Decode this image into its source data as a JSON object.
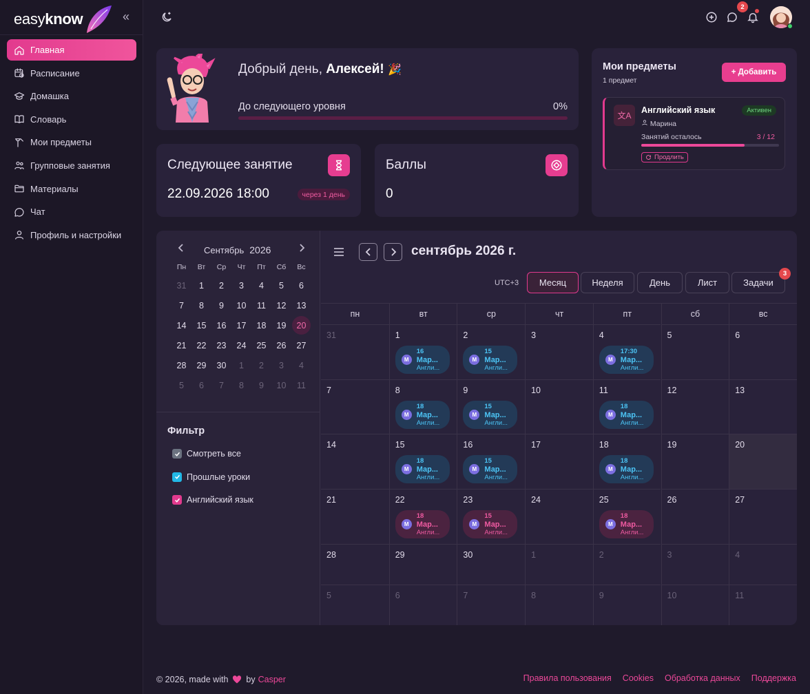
{
  "brand": {
    "logo_light": "easy",
    "logo_bold": "know",
    "accent": "#ec4899"
  },
  "sidebar": {
    "items": [
      {
        "label": "Главная",
        "icon": "home-icon",
        "active": true
      },
      {
        "label": "Расписание",
        "icon": "calendar-clock-icon"
      },
      {
        "label": "Домашка",
        "icon": "graduation-cap-icon"
      },
      {
        "label": "Словарь",
        "icon": "book-icon"
      },
      {
        "label": "Мои предметы",
        "icon": "tools-icon"
      },
      {
        "label": "Групповые занятия",
        "icon": "users-icon"
      },
      {
        "label": "Материалы",
        "icon": "folder-icon"
      },
      {
        "label": "Чат",
        "icon": "chat-icon"
      },
      {
        "label": "Профиль и настройки",
        "icon": "user-icon"
      }
    ]
  },
  "topbar": {
    "chat_badge": "2"
  },
  "greeting": {
    "prefix": "Добрый день, ",
    "name": "Алексей!",
    "emoji": "🎉",
    "level_label": "До следующего уровня",
    "level_value": "0%",
    "level_progress": 0
  },
  "next_lesson": {
    "title": "Следующее занятие",
    "datetime": "22.09.2026 18:00",
    "in": "через 1 день"
  },
  "score": {
    "title": "Баллы",
    "value": "0"
  },
  "subjects": {
    "title": "Мои предметы",
    "count": "1 предмет",
    "add_label": "+ Добавить",
    "card": {
      "icon_text": "文A",
      "name": "Английский язык",
      "status": "Активен",
      "teacher": "Марина",
      "left_label": "Занятий осталось",
      "left_value": "3 / 12",
      "progress": 0.75,
      "renew_label": "Продлить"
    }
  },
  "mini_calendar": {
    "month": "Сентябрь",
    "year": "2026",
    "weekdays": [
      "Пн",
      "Вт",
      "Ср",
      "Чт",
      "Пт",
      "Сб",
      "Вс"
    ],
    "weeks": [
      [
        "31",
        "1",
        "2",
        "3",
        "4",
        "5",
        "6"
      ],
      [
        "7",
        "8",
        "9",
        "10",
        "11",
        "12",
        "13"
      ],
      [
        "14",
        "15",
        "16",
        "17",
        "18",
        "19",
        "20"
      ],
      [
        "21",
        "22",
        "23",
        "24",
        "25",
        "26",
        "27"
      ],
      [
        "28",
        "29",
        "30",
        "1",
        "2",
        "3",
        "4"
      ],
      [
        "5",
        "6",
        "7",
        "8",
        "9",
        "10",
        "11"
      ]
    ],
    "selected": "20"
  },
  "filter": {
    "title": "Фильтр",
    "items": [
      {
        "label": "Смотреть все",
        "color": "#6b7280"
      },
      {
        "label": "Прошлые уроки",
        "color": "#22b8e6"
      },
      {
        "label": "Английский язык",
        "color": "#e23a8e"
      }
    ]
  },
  "calendar": {
    "title": "сентябрь 2026 г.",
    "timezone": "UTC+3",
    "views": [
      "Месяц",
      "Неделя",
      "День",
      "Лист",
      "Задачи"
    ],
    "active_view": "Месяц",
    "tasks_badge": "3",
    "dow": [
      "пн",
      "вт",
      "ср",
      "чт",
      "пт",
      "сб",
      "вс"
    ],
    "weeks": [
      [
        "31",
        "1",
        "2",
        "3",
        "4",
        "5",
        "6"
      ],
      [
        "7",
        "8",
        "9",
        "10",
        "11",
        "12",
        "13"
      ],
      [
        "14",
        "15",
        "16",
        "17",
        "18",
        "19",
        "20"
      ],
      [
        "21",
        "22",
        "23",
        "24",
        "25",
        "26",
        "27"
      ],
      [
        "28",
        "29",
        "30",
        "1",
        "2",
        "3",
        "4"
      ],
      [
        "5",
        "6",
        "7",
        "8",
        "9",
        "10",
        "11"
      ]
    ],
    "today": "20",
    "events": [
      {
        "week": 0,
        "day": 1,
        "time": "16",
        "name": "Мар...",
        "subject": "Англи...",
        "kind": "past"
      },
      {
        "week": 0,
        "day": 2,
        "time": "15",
        "name": "Мар...",
        "subject": "Англи...",
        "kind": "past"
      },
      {
        "week": 0,
        "day": 4,
        "time": "17:30",
        "name": "Мар...",
        "subject": "Англи...",
        "kind": "past"
      },
      {
        "week": 1,
        "day": 1,
        "time": "18",
        "name": "Мар...",
        "subject": "Англи...",
        "kind": "past"
      },
      {
        "week": 1,
        "day": 2,
        "time": "15",
        "name": "Мар...",
        "subject": "Англи...",
        "kind": "past"
      },
      {
        "week": 1,
        "day": 4,
        "time": "18",
        "name": "Мар...",
        "subject": "Англи...",
        "kind": "past"
      },
      {
        "week": 2,
        "day": 1,
        "time": "18",
        "name": "Мар...",
        "subject": "Англи...",
        "kind": "past"
      },
      {
        "week": 2,
        "day": 2,
        "time": "15",
        "name": "Мар...",
        "subject": "Англи...",
        "kind": "past"
      },
      {
        "week": 2,
        "day": 4,
        "time": "18",
        "name": "Мар...",
        "subject": "Англи...",
        "kind": "past"
      },
      {
        "week": 3,
        "day": 1,
        "time": "18",
        "name": "Мар...",
        "subject": "Англи...",
        "kind": "upcoming"
      },
      {
        "week": 3,
        "day": 2,
        "time": "15",
        "name": "Мар...",
        "subject": "Англи...",
        "kind": "upcoming"
      },
      {
        "week": 3,
        "day": 4,
        "time": "18",
        "name": "Мар...",
        "subject": "Англи...",
        "kind": "upcoming"
      }
    ],
    "avatar_letter": "M"
  },
  "footer": {
    "copyright": "© 2026, made with",
    "by": "by",
    "author": "Casper",
    "links": [
      "Правила пользования",
      "Cookies",
      "Обработка данных",
      "Поддержка"
    ]
  }
}
